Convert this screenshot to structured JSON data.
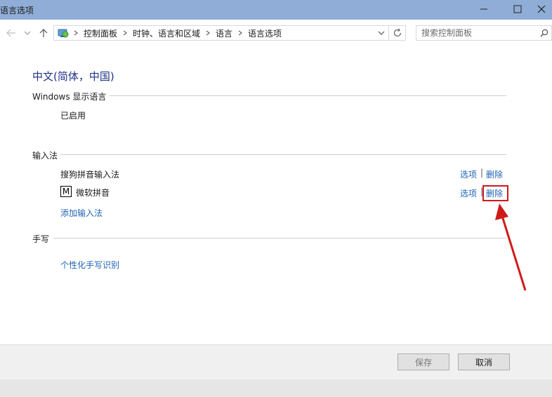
{
  "window": {
    "title": "语言选项"
  },
  "address_bar": {
    "breadcrumbs": [
      "控制面板",
      "时钟、语言和区域",
      "语言",
      "语言选项"
    ],
    "search_placeholder": "搜索控制面板"
  },
  "language": {
    "name": "中文(简体，中国)"
  },
  "display_language": {
    "heading": "Windows 显示语言",
    "status": "已启用"
  },
  "input_methods": {
    "heading": "输入法",
    "items": [
      {
        "name": "搜狗拼音输入法",
        "options_label": "选项",
        "delete_label": "删除"
      },
      {
        "name": "微软拼音",
        "options_label": "选项",
        "delete_label": "删除",
        "badge": "M"
      }
    ],
    "separator": "|",
    "add_label": "添加输入法"
  },
  "handwriting": {
    "heading": "手写",
    "personalize_label": "个性化手写识别"
  },
  "footer": {
    "save_label": "保存",
    "cancel_label": "取消"
  },
  "colors": {
    "titlebar": "#8fadd6",
    "link": "#1f63b6",
    "language_title": "#1e3287",
    "highlight": "#d01a1a"
  },
  "icons": [
    "minimize-icon",
    "maximize-icon",
    "close-icon",
    "back-arrow-icon",
    "recent-dropdown-icon",
    "up-arrow-icon",
    "control-panel-icon",
    "chevron-right-icon",
    "chevron-down-icon",
    "refresh-icon",
    "search-icon",
    "ime-m-icon",
    "red-arrow-annotation"
  ]
}
